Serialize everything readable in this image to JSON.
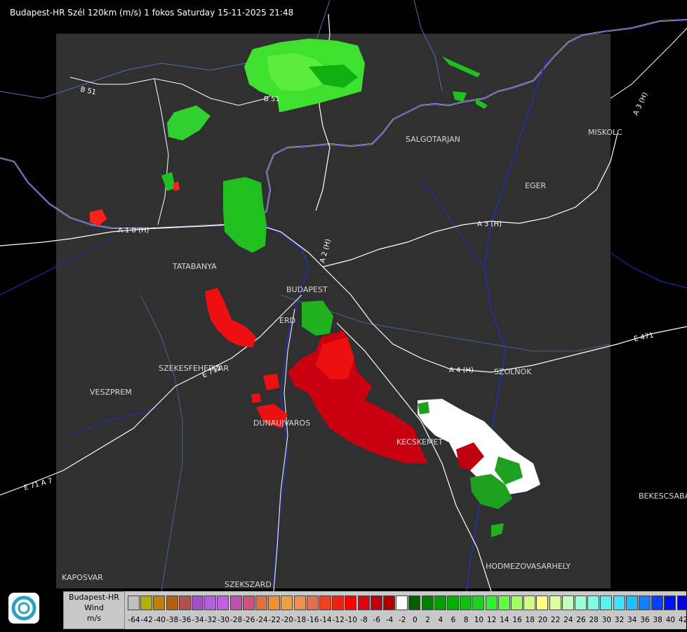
{
  "title": "Budapest-HR Szél 120km (m/s) 1 fokos Saturday 15-11-2025 21:48",
  "cities": [
    {
      "name": "SALGOTARJAN"
    },
    {
      "name": "MISKOLC"
    },
    {
      "name": "EGER"
    },
    {
      "name": "TATABANYA"
    },
    {
      "name": "BUDAPEST"
    },
    {
      "name": "ERD"
    },
    {
      "name": "SZEKESFEHERVAR"
    },
    {
      "name": "VESZPREM"
    },
    {
      "name": "DUNAUJVAROS"
    },
    {
      "name": "KECSKEMET"
    },
    {
      "name": "SZOLNOK"
    },
    {
      "name": "BEKESCSABA"
    },
    {
      "name": "HODMEZOVASARHELY"
    },
    {
      "name": "KAPOSVAR"
    },
    {
      "name": "SZEKSZARD"
    }
  ],
  "roads": [
    {
      "name": "B 51"
    },
    {
      "name": "B 51"
    },
    {
      "name": "A 1 0 (H)"
    },
    {
      "name": "A 2 (H)"
    },
    {
      "name": "A 3 (H)"
    },
    {
      "name": "A 3 (H)"
    },
    {
      "name": "A 4 (H)"
    },
    {
      "name": "E 471"
    },
    {
      "name": "E 712"
    },
    {
      "name": "E 71 A 7"
    }
  ],
  "legend": {
    "line1": "Budapest-HR",
    "line2": "Wind",
    "line3": "m/s"
  },
  "scale": {
    "colors": [
      "#bfbfbf",
      "#b0b000",
      "#c08000",
      "#b06010",
      "#b05050",
      "#a050c0",
      "#b060e0",
      "#c060e0",
      "#c050b0",
      "#d05080",
      "#e07040",
      "#f09030",
      "#f0a040",
      "#f09050",
      "#e07050",
      "#f04020",
      "#f02010",
      "#ff0000",
      "#e00010",
      "#c00010",
      "#b00000",
      "#ffffff",
      "#006000",
      "#008000",
      "#00a000",
      "#00b000",
      "#10c010",
      "#20d020",
      "#30f030",
      "#60ff40",
      "#a0ff60",
      "#d0ff80",
      "#ffff80",
      "#e0ffa0",
      "#c0ffc0",
      "#a0ffd0",
      "#80ffe0",
      "#60f0f0",
      "#40e0ff",
      "#20c0ff",
      "#1080ff",
      "#0040ff",
      "#0010ff",
      "#0000e0"
    ],
    "ticks": [
      "-64",
      "-42",
      "-40",
      "-38",
      "-36",
      "-34",
      "-32",
      "-30",
      "-28",
      "-26",
      "-24",
      "-22",
      "-20",
      "-18",
      "-16",
      "-14",
      "-12",
      "-10",
      "-8",
      "-6",
      "-4",
      "-2",
      "0",
      "2",
      "4",
      "6",
      "8",
      "10",
      "12",
      "14",
      "16",
      "18",
      "20",
      "22",
      "24",
      "26",
      "28",
      "30",
      "32",
      "34",
      "36",
      "38",
      "40",
      "42"
    ]
  }
}
